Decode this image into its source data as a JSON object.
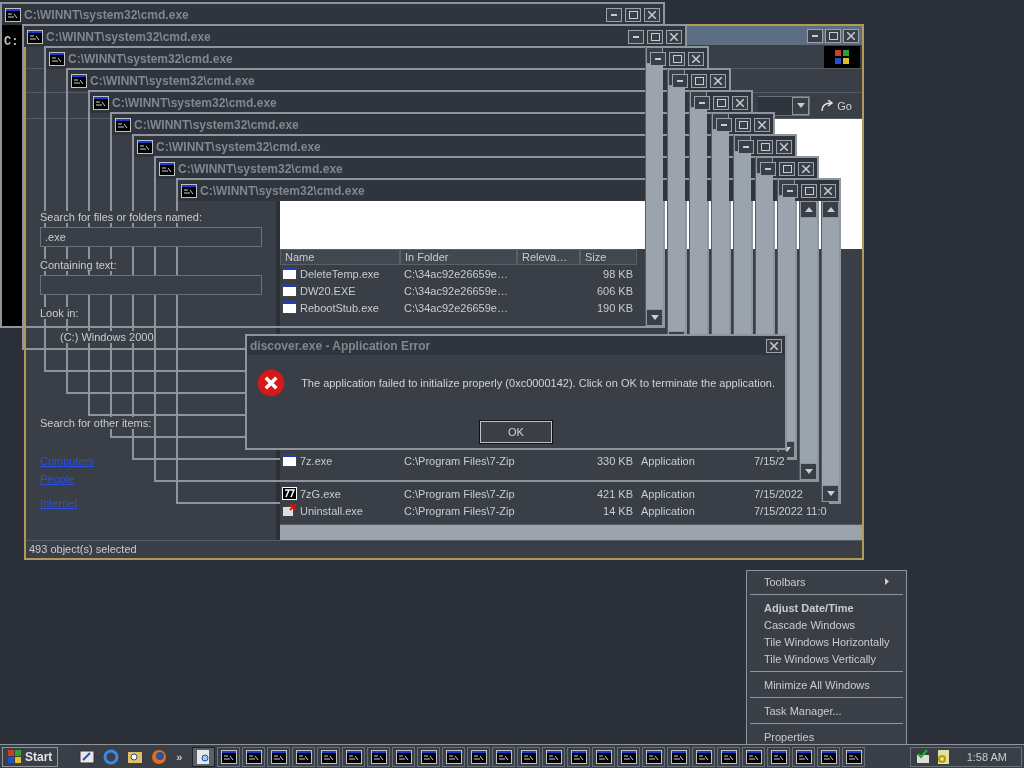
{
  "search_window": {
    "go_button": "Go",
    "sidebar": {
      "named_label": "Search for files or folders named:",
      "named_value": ".exe",
      "containing_label": "Containing text:",
      "look_in_label": "Look in:",
      "look_in_value": "(C:) Windows 2000",
      "other_items_label": "Search for other items:",
      "links": [
        "Computers",
        "People",
        "Internet"
      ]
    },
    "results": {
      "columns": [
        "Name",
        "In Folder",
        "Releva…",
        "Size"
      ],
      "rows_top": [
        {
          "kind": "program",
          "name": "DeleteTemp.exe",
          "folder": "C:\\34ac92e26659e…",
          "size": "98 KB"
        },
        {
          "kind": "program",
          "name": "DW20.EXE",
          "folder": "C:\\34ac92e26659e…",
          "size": "606 KB"
        },
        {
          "kind": "program",
          "name": "RebootStub.exe",
          "folder": "C:\\34ac92e26659e…",
          "size": "190 KB"
        }
      ],
      "rows_bottom": [
        {
          "kind": "program",
          "name": "7z.exe",
          "folder": "C:\\Program Files\\7-Zip",
          "size": "330 KB",
          "type": "Application",
          "modified": "7/15/2"
        },
        {
          "kind": "archive",
          "name": "7zG.exe",
          "folder": "C:\\Program Files\\7-Zip",
          "size": "421 KB",
          "type": "Application",
          "modified": "7/15/2022"
        },
        {
          "kind": "uninstall",
          "name": "Uninstall.exe",
          "folder": "C:\\Program Files\\7-Zip",
          "size": "14 KB",
          "type": "Application",
          "modified": "7/15/2022 11:0"
        }
      ]
    },
    "status": "493 object(s) selected"
  },
  "cmd_windows": [
    {
      "title": "C:\\WINNT\\system32\\cmd.exe",
      "console_text": "C:"
    },
    {
      "title": "C:\\WINNT\\system32\\cmd.exe"
    },
    {
      "title": "C:\\WINNT\\system32\\cmd.exe"
    },
    {
      "title": "C:\\WINNT\\system32\\cmd.exe"
    },
    {
      "title": "C:\\WINNT\\system32\\cmd.exe"
    },
    {
      "title": "C:\\WINNT\\system32\\cmd.exe"
    },
    {
      "title": "C:\\WINNT\\system32\\cmd.exe"
    },
    {
      "title": "C:\\WINNT\\system32\\cmd.exe"
    },
    {
      "title": "C:\\WINNT\\system32\\cmd.exe"
    }
  ],
  "dialog": {
    "title": "discover.exe - Application Error",
    "message": "The application failed to initialize properly (0xc0000142). Click on OK to terminate the application.",
    "button": "OK"
  },
  "context_menu": {
    "items": [
      {
        "kind": "submenu",
        "label": "Toolbars"
      },
      {
        "kind": "separator"
      },
      {
        "kind": "default",
        "label": "Adjust Date/Time"
      },
      {
        "kind": "item",
        "label": "Cascade Windows"
      },
      {
        "kind": "item",
        "label": "Tile Windows Horizontally"
      },
      {
        "kind": "item",
        "label": "Tile Windows Vertically"
      },
      {
        "kind": "separator"
      },
      {
        "kind": "item",
        "label": "Minimize All Windows"
      },
      {
        "kind": "separator"
      },
      {
        "kind": "item",
        "label": "Task Manager..."
      },
      {
        "kind": "separator"
      },
      {
        "kind": "item",
        "label": "Properties"
      }
    ]
  },
  "taskbar": {
    "start": "Start",
    "more": "»",
    "clock": "1:58 AM",
    "tasks": [
      {
        "kind": "search",
        "selected": true
      },
      {
        "kind": "console",
        "selected": false
      },
      {
        "kind": "console",
        "selected": false
      },
      {
        "kind": "console",
        "selected": false
      },
      {
        "kind": "console",
        "selected": false
      },
      {
        "kind": "console",
        "selected": false
      },
      {
        "kind": "console",
        "selected": false
      },
      {
        "kind": "console",
        "selected": false
      },
      {
        "kind": "console",
        "selected": false
      },
      {
        "kind": "console",
        "selected": false
      },
      {
        "kind": "console",
        "selected": false
      },
      {
        "kind": "console",
        "selected": false
      },
      {
        "kind": "console",
        "selected": false
      },
      {
        "kind": "console",
        "selected": false
      },
      {
        "kind": "console",
        "selected": false
      },
      {
        "kind": "console",
        "selected": false
      },
      {
        "kind": "console",
        "selected": false
      },
      {
        "kind": "console",
        "selected": false
      },
      {
        "kind": "console",
        "selected": false
      },
      {
        "kind": "console",
        "selected": false
      },
      {
        "kind": "console",
        "selected": false
      },
      {
        "kind": "console",
        "selected": false
      },
      {
        "kind": "console",
        "selected": false
      },
      {
        "kind": "console",
        "selected": false
      },
      {
        "kind": "console",
        "selected": false
      },
      {
        "kind": "console",
        "selected": false
      },
      {
        "kind": "console",
        "selected": false
      }
    ]
  }
}
